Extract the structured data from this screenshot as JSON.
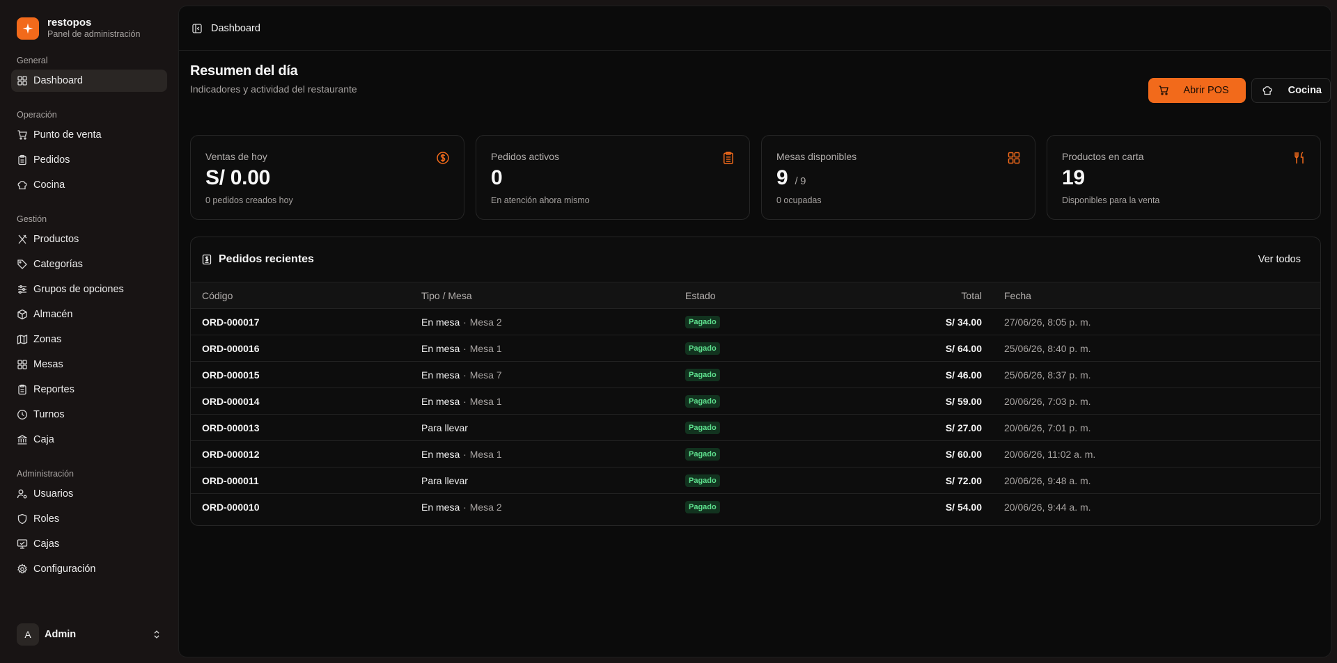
{
  "brand": {
    "name": "restopos",
    "subtitle": "Panel de administración"
  },
  "nav": {
    "groups": [
      {
        "label": "General",
        "items": [
          {
            "label": "Dashboard",
            "icon": "grid-icon",
            "active": true
          }
        ]
      },
      {
        "label": "Operación",
        "items": [
          {
            "label": "Punto de venta",
            "icon": "cart-icon"
          },
          {
            "label": "Pedidos",
            "icon": "clipboard-icon"
          },
          {
            "label": "Cocina",
            "icon": "chef-hat-icon"
          }
        ]
      },
      {
        "label": "Gestión",
        "items": [
          {
            "label": "Productos",
            "icon": "utensils-icon"
          },
          {
            "label": "Categorías",
            "icon": "tag-icon"
          },
          {
            "label": "Grupos de opciones",
            "icon": "sliders-icon"
          },
          {
            "label": "Almacén",
            "icon": "package-icon"
          },
          {
            "label": "Zonas",
            "icon": "map-icon"
          },
          {
            "label": "Mesas",
            "icon": "grid-icon"
          },
          {
            "label": "Reportes",
            "icon": "clipboard-icon"
          },
          {
            "label": "Turnos",
            "icon": "clock-icon"
          },
          {
            "label": "Caja",
            "icon": "bank-icon"
          }
        ]
      },
      {
        "label": "Administración",
        "items": [
          {
            "label": "Usuarios",
            "icon": "user-cog-icon"
          },
          {
            "label": "Roles",
            "icon": "shield-icon"
          },
          {
            "label": "Cajas",
            "icon": "monitor-icon"
          },
          {
            "label": "Configuración",
            "icon": "gear-icon"
          }
        ]
      }
    ]
  },
  "user": {
    "initial": "A",
    "name": "Admin"
  },
  "topbar": {
    "breadcrumb": "Dashboard"
  },
  "page": {
    "title": "Resumen del día",
    "subtitle": "Indicadores y actividad del restaurante"
  },
  "actions": {
    "open_pos": "Abrir POS",
    "kitchen": "Cocina"
  },
  "stats": [
    {
      "label": "Ventas de hoy",
      "value": "S/ 0.00",
      "of": "",
      "foot": "0 pedidos creados hoy",
      "icon": "dollar-circle-icon"
    },
    {
      "label": "Pedidos activos",
      "value": "0",
      "of": "",
      "foot": "En atención ahora mismo",
      "icon": "clipboard-icon"
    },
    {
      "label": "Mesas disponibles",
      "value": "9",
      "of": "/ 9",
      "foot": "0 ocupadas",
      "icon": "grid-icon"
    },
    {
      "label": "Productos en carta",
      "value": "19",
      "of": "",
      "foot": "Disponibles para la venta",
      "icon": "utensils-icon"
    }
  ],
  "orders": {
    "title": "Pedidos recientes",
    "see_all": "Ver todos",
    "columns": [
      "Código",
      "Tipo / Mesa",
      "Estado",
      "Total",
      "Fecha"
    ],
    "rows": [
      {
        "code": "ORD-000017",
        "type": "En mesa",
        "table": "Mesa 2",
        "status": "Pagado",
        "total": "S/ 34.00",
        "date": "27/06/26, 8:05 p. m."
      },
      {
        "code": "ORD-000016",
        "type": "En mesa",
        "table": "Mesa 1",
        "status": "Pagado",
        "total": "S/ 64.00",
        "date": "25/06/26, 8:40 p. m."
      },
      {
        "code": "ORD-000015",
        "type": "En mesa",
        "table": "Mesa 7",
        "status": "Pagado",
        "total": "S/ 46.00",
        "date": "25/06/26, 8:37 p. m."
      },
      {
        "code": "ORD-000014",
        "type": "En mesa",
        "table": "Mesa 1",
        "status": "Pagado",
        "total": "S/ 59.00",
        "date": "20/06/26, 7:03 p. m."
      },
      {
        "code": "ORD-000013",
        "type": "Para llevar",
        "table": "",
        "status": "Pagado",
        "total": "S/ 27.00",
        "date": "20/06/26, 7:01 p. m."
      },
      {
        "code": "ORD-000012",
        "type": "En mesa",
        "table": "Mesa 1",
        "status": "Pagado",
        "total": "S/ 60.00",
        "date": "20/06/26, 11:02 a. m."
      },
      {
        "code": "ORD-000011",
        "type": "Para llevar",
        "table": "",
        "status": "Pagado",
        "total": "S/ 72.00",
        "date": "20/06/26, 9:48 a. m."
      },
      {
        "code": "ORD-000010",
        "type": "En mesa",
        "table": "Mesa 2",
        "status": "Pagado",
        "total": "S/ 54.00",
        "date": "20/06/26, 9:44 a. m."
      }
    ]
  },
  "colors": {
    "accent": "#f26a1b",
    "paid_badge": "#5ee08e",
    "background": "#0b0b0b"
  }
}
